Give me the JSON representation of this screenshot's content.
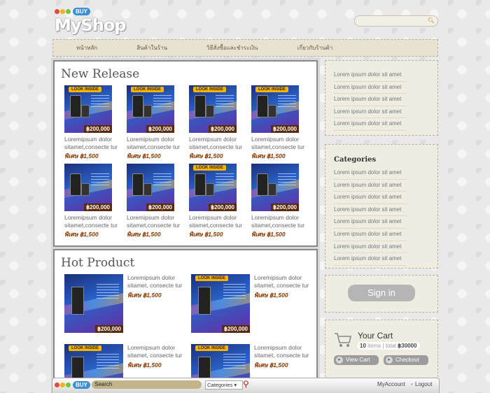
{
  "header": {
    "brand": "MyShop",
    "buy_badge": "BUY",
    "search_placeholder": ""
  },
  "nav": [
    "หน้าหลัก",
    "สินค้าในร้าน",
    "วิธีสั่งซื้อและชำระเงิน",
    "เกี่ยวกับร้านค้า"
  ],
  "new_release": {
    "title": "New Release",
    "products": [
      {
        "tag": "LOOK INSIDE",
        "price": "฿200,000",
        "name": "Loremipsum dolor sitamet,consecte tur",
        "sale_label": "พิเศษ",
        "sale_price": "฿1,500"
      },
      {
        "tag": "LOOK INSIDE",
        "price": "฿200,000",
        "name": "Loremipsum dolor sitamet,consecte tur",
        "sale_label": "พิเศษ",
        "sale_price": "฿1,500"
      },
      {
        "tag": "LOOK INSIDE",
        "price": "฿200,000",
        "name": "Loremipsum dolor sitamet,consecte tur",
        "sale_label": "พิเศษ",
        "sale_price": "฿1,500"
      },
      {
        "tag": "LOOK INSIDE",
        "price": "฿200,000",
        "name": "Loremipsum dolor sitamet,consecte tur",
        "sale_label": "พิเศษ",
        "sale_price": "฿1,500"
      },
      {
        "tag": "",
        "price": "฿200,000",
        "name": "Loremipsum dolor sitamet,consecte tur",
        "sale_label": "พิเศษ",
        "sale_price": "฿1,500"
      },
      {
        "tag": "",
        "price": "฿200,000",
        "name": "Loremipsum dolor sitamet,consecte tur",
        "sale_label": "พิเศษ",
        "sale_price": "฿1,500"
      },
      {
        "tag": "LOOK INSIDE",
        "price": "฿200,000",
        "name": "Loremipsum dolor sitamet,consecte tur",
        "sale_label": "พิเศษ",
        "sale_price": "฿1,500"
      },
      {
        "tag": "",
        "price": "฿200,000",
        "name": "Loremipsum dolor sitamet,consecte tur",
        "sale_label": "พิเศษ",
        "sale_price": "฿1,500"
      }
    ]
  },
  "hot_product": {
    "title": "Hot Product",
    "products": [
      {
        "tag": "",
        "price": "฿200,000",
        "name": "Loremipsum dolor sitamet, consecte tur",
        "sale_label": "พิเศษ",
        "sale_price": "฿1,500"
      },
      {
        "tag": "LOOK INSIDE",
        "price": "฿200,000",
        "name": "Loremipsum dolor sitamet, consecte tur",
        "sale_label": "พิเศษ",
        "sale_price": "฿1,500"
      },
      {
        "tag": "LOOK INSIDE",
        "price": "",
        "name": "Loremipsum dolor sitamet, consecte tur",
        "sale_label": "พิเศษ",
        "sale_price": "฿1,500"
      },
      {
        "tag": "LOOK INSIDE",
        "price": "",
        "name": "Loremipsum dolor sitamet, consecte tur",
        "sale_label": "พิเศษ",
        "sale_price": "฿1,500"
      }
    ]
  },
  "sidebar": {
    "links": [
      "Lorem ipsum dolor sit amet",
      "Lorem ipsum dolor sit amet",
      "Lorem ipsum dolor sit amet",
      "Lorem ipsum dolor sit amet",
      "Lorem ipsum dolor sit amet"
    ],
    "categories_title": "Categories",
    "categories": [
      "Lorem ipsum dolor sit amet",
      "Lorem ipsum dolor sit amet",
      "Lorem ipsum dolor sit amet",
      "Lorem ipsum dolor sit amet",
      "Lorem ipsum dolor sit amet",
      "Lorem ipsum dolor sit amet",
      "Lorem ipsum dolor sit amet",
      "Lorem ipsum dolor sit amet"
    ],
    "sign_in": "Sign in",
    "cart": {
      "title": "Your Cart",
      "items_count": "10",
      "items_label": "items",
      "total_label": "total",
      "total_value": "฿30000",
      "view_cart": "View Cart",
      "checkout": "Checkout"
    }
  },
  "toolbar": {
    "buy_badge": "BUY",
    "search_label": "Search",
    "category_select": "Categories",
    "my_account": "MyAccount",
    "separator": "•",
    "logout": "Logout"
  },
  "colors": {
    "accent_brown": "#5a2a0a",
    "tag_yellow": "#f5b400",
    "nav_bg": "#e7e2d2"
  }
}
